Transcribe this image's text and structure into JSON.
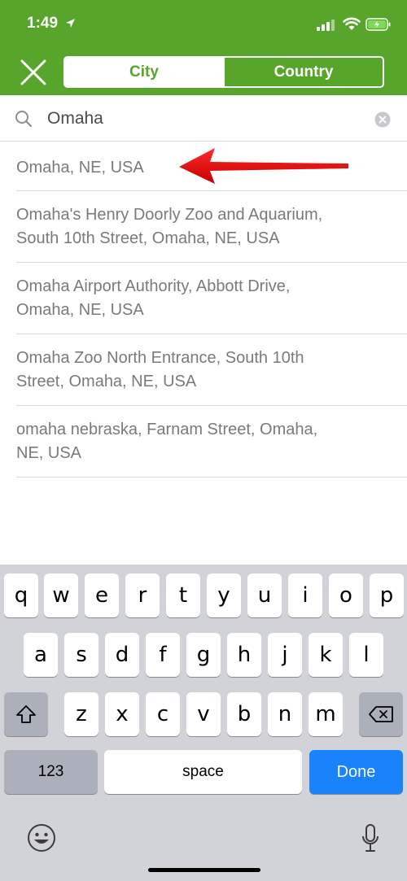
{
  "status_bar": {
    "time": "1:49"
  },
  "header": {
    "segments": [
      {
        "label": "City",
        "active": true
      },
      {
        "label": "Country",
        "active": false
      }
    ],
    "accent_color": "#57a52a"
  },
  "search": {
    "value": "Omaha",
    "placeholder": ""
  },
  "results": [
    {
      "lines": [
        "Omaha, NE, USA"
      ]
    },
    {
      "lines": [
        "Omaha's Henry Doorly Zoo and Aquarium,",
        "South 10th Street, Omaha, NE, USA"
      ]
    },
    {
      "lines": [
        "Omaha Airport Authority, Abbott Drive,",
        "Omaha, NE, USA"
      ]
    },
    {
      "lines": [
        "Omaha Zoo North Entrance, South 10th",
        "Street, Omaha, NE, USA"
      ]
    },
    {
      "lines": [
        "omaha nebraska, Farnam Street, Omaha,",
        "NE, USA"
      ]
    }
  ],
  "keyboard": {
    "row1": [
      "q",
      "w",
      "e",
      "r",
      "t",
      "y",
      "u",
      "i",
      "o",
      "p"
    ],
    "row2": [
      "a",
      "s",
      "d",
      "f",
      "g",
      "h",
      "j",
      "k",
      "l"
    ],
    "row3": [
      "z",
      "x",
      "c",
      "v",
      "b",
      "n",
      "m"
    ],
    "numbers_label": "123",
    "space_label": "space",
    "done_label": "Done"
  },
  "icons": {
    "close": "close-icon",
    "search": "search-icon",
    "clear": "clear-icon",
    "shift": "shift-icon",
    "backspace": "backspace-icon",
    "emoji": "emoji-icon",
    "mic": "microphone-icon",
    "annotation": "red-arrow-icon"
  }
}
